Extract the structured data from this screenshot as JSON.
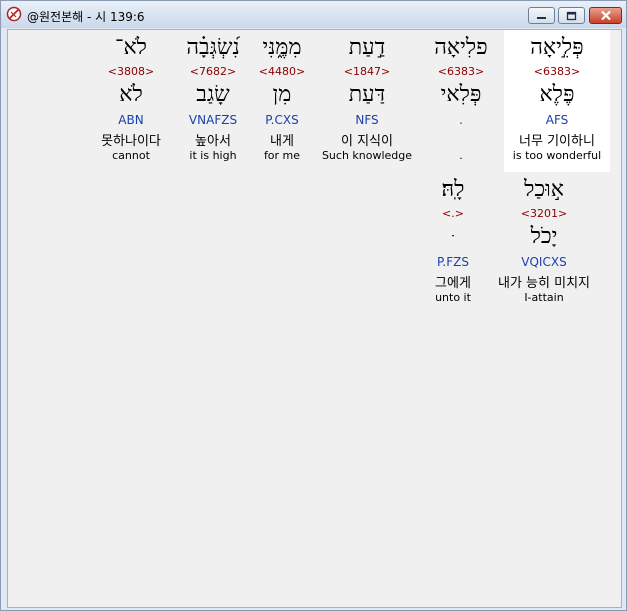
{
  "window": {
    "title": "@원전본해 - 시 139:6"
  },
  "controls": {
    "minimize": "minimize",
    "maximize": "maximize",
    "close": "close"
  },
  "words": [
    {
      "heb": "פְּלִ֣יאָה",
      "num": "<6383>",
      "root": "פֶּלֶא",
      "morph": "AFS",
      "kor": "너무 기이하니",
      "eng": "is too wonderful"
    },
    {
      "heb": "פלִיאָה",
      "num": "<6383>",
      "root": "פְּלִאי",
      "morph": ".",
      "kor": "",
      "eng": "."
    },
    {
      "heb": "דַ֣עַת",
      "num": "<1847>",
      "root": "דַּעַת",
      "morph": "NFS",
      "kor": "이 지식이",
      "eng": "Such knowledge"
    },
    {
      "heb": "מִמֶּ֑נִּי",
      "num": "<4480>",
      "root": "מִן",
      "morph": "P.CXS",
      "kor": "내게",
      "eng": "for me"
    },
    {
      "heb": "נִ֝שְׂגְּבָ֗ה",
      "num": "<7682>",
      "root": "שָׂגַב",
      "morph": "VNAFZS",
      "kor": "높아서",
      "eng": "it is high"
    },
    {
      "heb": "לֹא־",
      "num": "<3808>",
      "root": "לֹא",
      "morph": "ABN",
      "kor": "못하나이다",
      "eng": "cannot"
    },
    {
      "heb": "א֣וּכַל",
      "num": "<3201>",
      "root": "יָכֹל",
      "morph": "VQICXS",
      "kor": "내가 능히 미치지",
      "eng": "I-attain"
    },
    {
      "heb": "לָֽהּ׃",
      "num": "<.>",
      "root": "ּ",
      "morph": "P.FZS",
      "kor": "그에게",
      "eng": "unto it"
    }
  ]
}
